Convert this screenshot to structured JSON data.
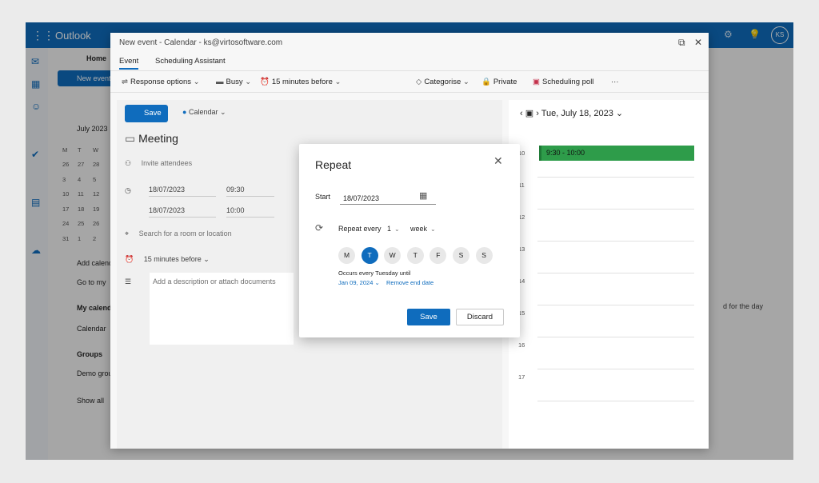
{
  "outlook": {
    "brand": "Outlook",
    "avatar": "KS",
    "new_button": "New event",
    "home_tab": "Home",
    "mini_calendar_month": "July 2023",
    "weekday_headers": [
      "M",
      "T",
      "W"
    ],
    "mini_weeks": [
      [
        "26",
        "27",
        "28"
      ],
      [
        "3",
        "4",
        "5"
      ],
      [
        "10",
        "11",
        "12"
      ],
      [
        "17",
        "18",
        "19"
      ],
      [
        "24",
        "25",
        "26"
      ],
      [
        "31",
        "1",
        "2"
      ]
    ],
    "nav_items": [
      "Add calendar",
      "Go to my",
      "My calendars",
      "Calendar",
      "Groups",
      "Demo group",
      "Show all"
    ],
    "right_text": "d for the day"
  },
  "event_window": {
    "title": "New event - Calendar - ks@virtosoftware.com",
    "tabs": [
      "Event",
      "Scheduling Assistant"
    ],
    "toolbar": {
      "response_options": "Response options",
      "busy": "Busy",
      "reminder": "15 minutes before",
      "categorise": "Categorise",
      "private": "Private",
      "scheduling_poll": "Scheduling poll",
      "more": "···"
    },
    "save_label": "Save",
    "calendar_label": "Calendar",
    "title_value": "Meeting",
    "invite_placeholder": "Invite attendees",
    "start_date": "18/07/2023",
    "start_time": "09:30",
    "end_date": "18/07/2023",
    "end_time": "10:00",
    "location_placeholder": "Search for a room or location",
    "reminder_value": "15 minutes before",
    "description_placeholder": "Add a description or attach documents"
  },
  "day_view": {
    "date_label": "Tue, July 18, 2023",
    "hours": [
      "10",
      "11",
      "12",
      "13",
      "14",
      "15",
      "16",
      "17"
    ],
    "event_label": "9:30 - 10:00",
    "event_color": "#2e9c4a"
  },
  "repeat_dialog": {
    "title": "Repeat",
    "start_label": "Start",
    "start_value": "18/07/2023",
    "repeat_every_label": "Repeat every",
    "interval": "1",
    "unit": "week",
    "days": [
      {
        "letter": "M",
        "selected": false
      },
      {
        "letter": "T",
        "selected": true
      },
      {
        "letter": "W",
        "selected": false
      },
      {
        "letter": "T",
        "selected": false
      },
      {
        "letter": "F",
        "selected": false
      },
      {
        "letter": "S",
        "selected": false
      },
      {
        "letter": "S",
        "selected": false
      }
    ],
    "occurs_text": "Occurs every Tuesday until",
    "end_date": "Jan 09, 2024",
    "remove_end_date": "Remove end date",
    "save_label": "Save",
    "discard_label": "Discard",
    "accent_color": "#0f6cbd"
  }
}
